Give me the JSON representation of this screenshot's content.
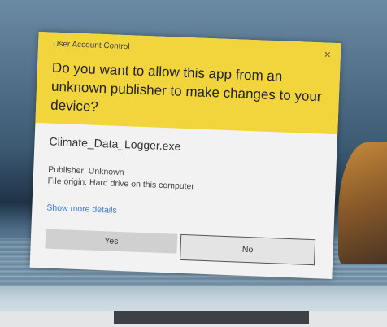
{
  "dialog": {
    "window_label": "User Account Control",
    "question": "Do you want to allow this app from an unknown publisher to make changes to your device?",
    "app_name": "Climate_Data_Logger.exe",
    "publisher": "Publisher: Unknown",
    "file_origin": "File origin: Hard drive on this computer",
    "show_more": "Show more details",
    "yes_label": "Yes",
    "no_label": "No",
    "close_icon": "×",
    "accent_color": "#f2d53c"
  }
}
